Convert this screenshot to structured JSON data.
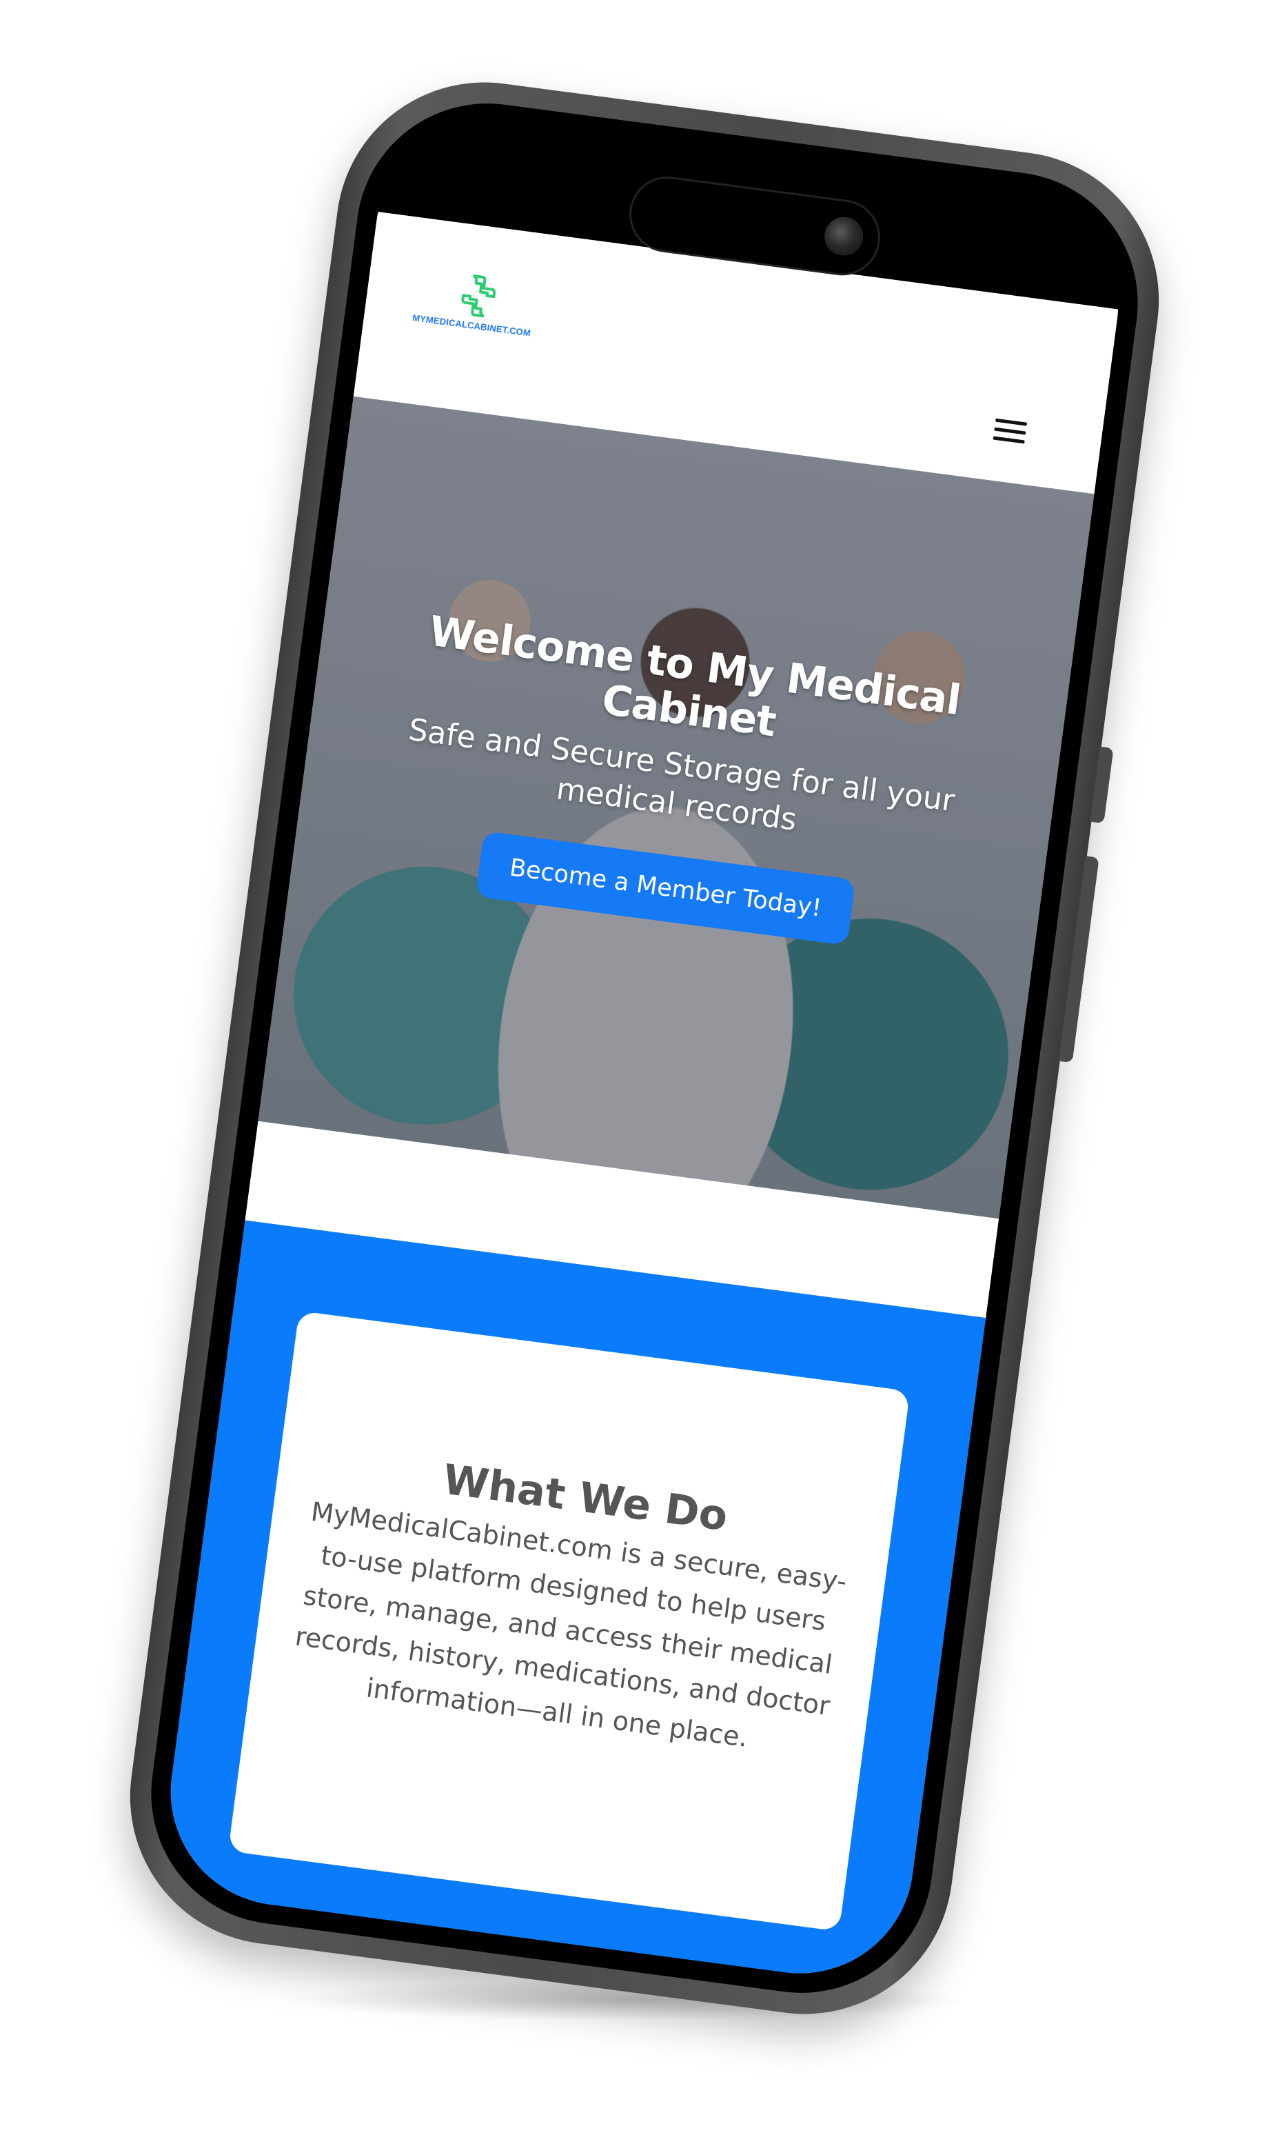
{
  "logo": {
    "text": "MYMEDICALCABINET.COM",
    "icon": "medical-cross-icon"
  },
  "header": {
    "menu_icon": "hamburger-menu-icon"
  },
  "hero": {
    "title": "Welcome to My Medical Cabinet",
    "subtitle": "Safe and Secure Storage for all your medical records",
    "cta_label": "Become a Member Today!"
  },
  "what_we_do": {
    "title": "What We Do",
    "body": "MyMedicalCabinet.com is a secure, easy-to-use platform designed to help users store, manage, and access their medical records, history, medications, and doctor information—all in one place."
  },
  "colors": {
    "brand_blue": "#0a7bfa",
    "button_blue": "#1679f5",
    "logo_green": "#2ecc71",
    "text_gray": "#555555"
  }
}
